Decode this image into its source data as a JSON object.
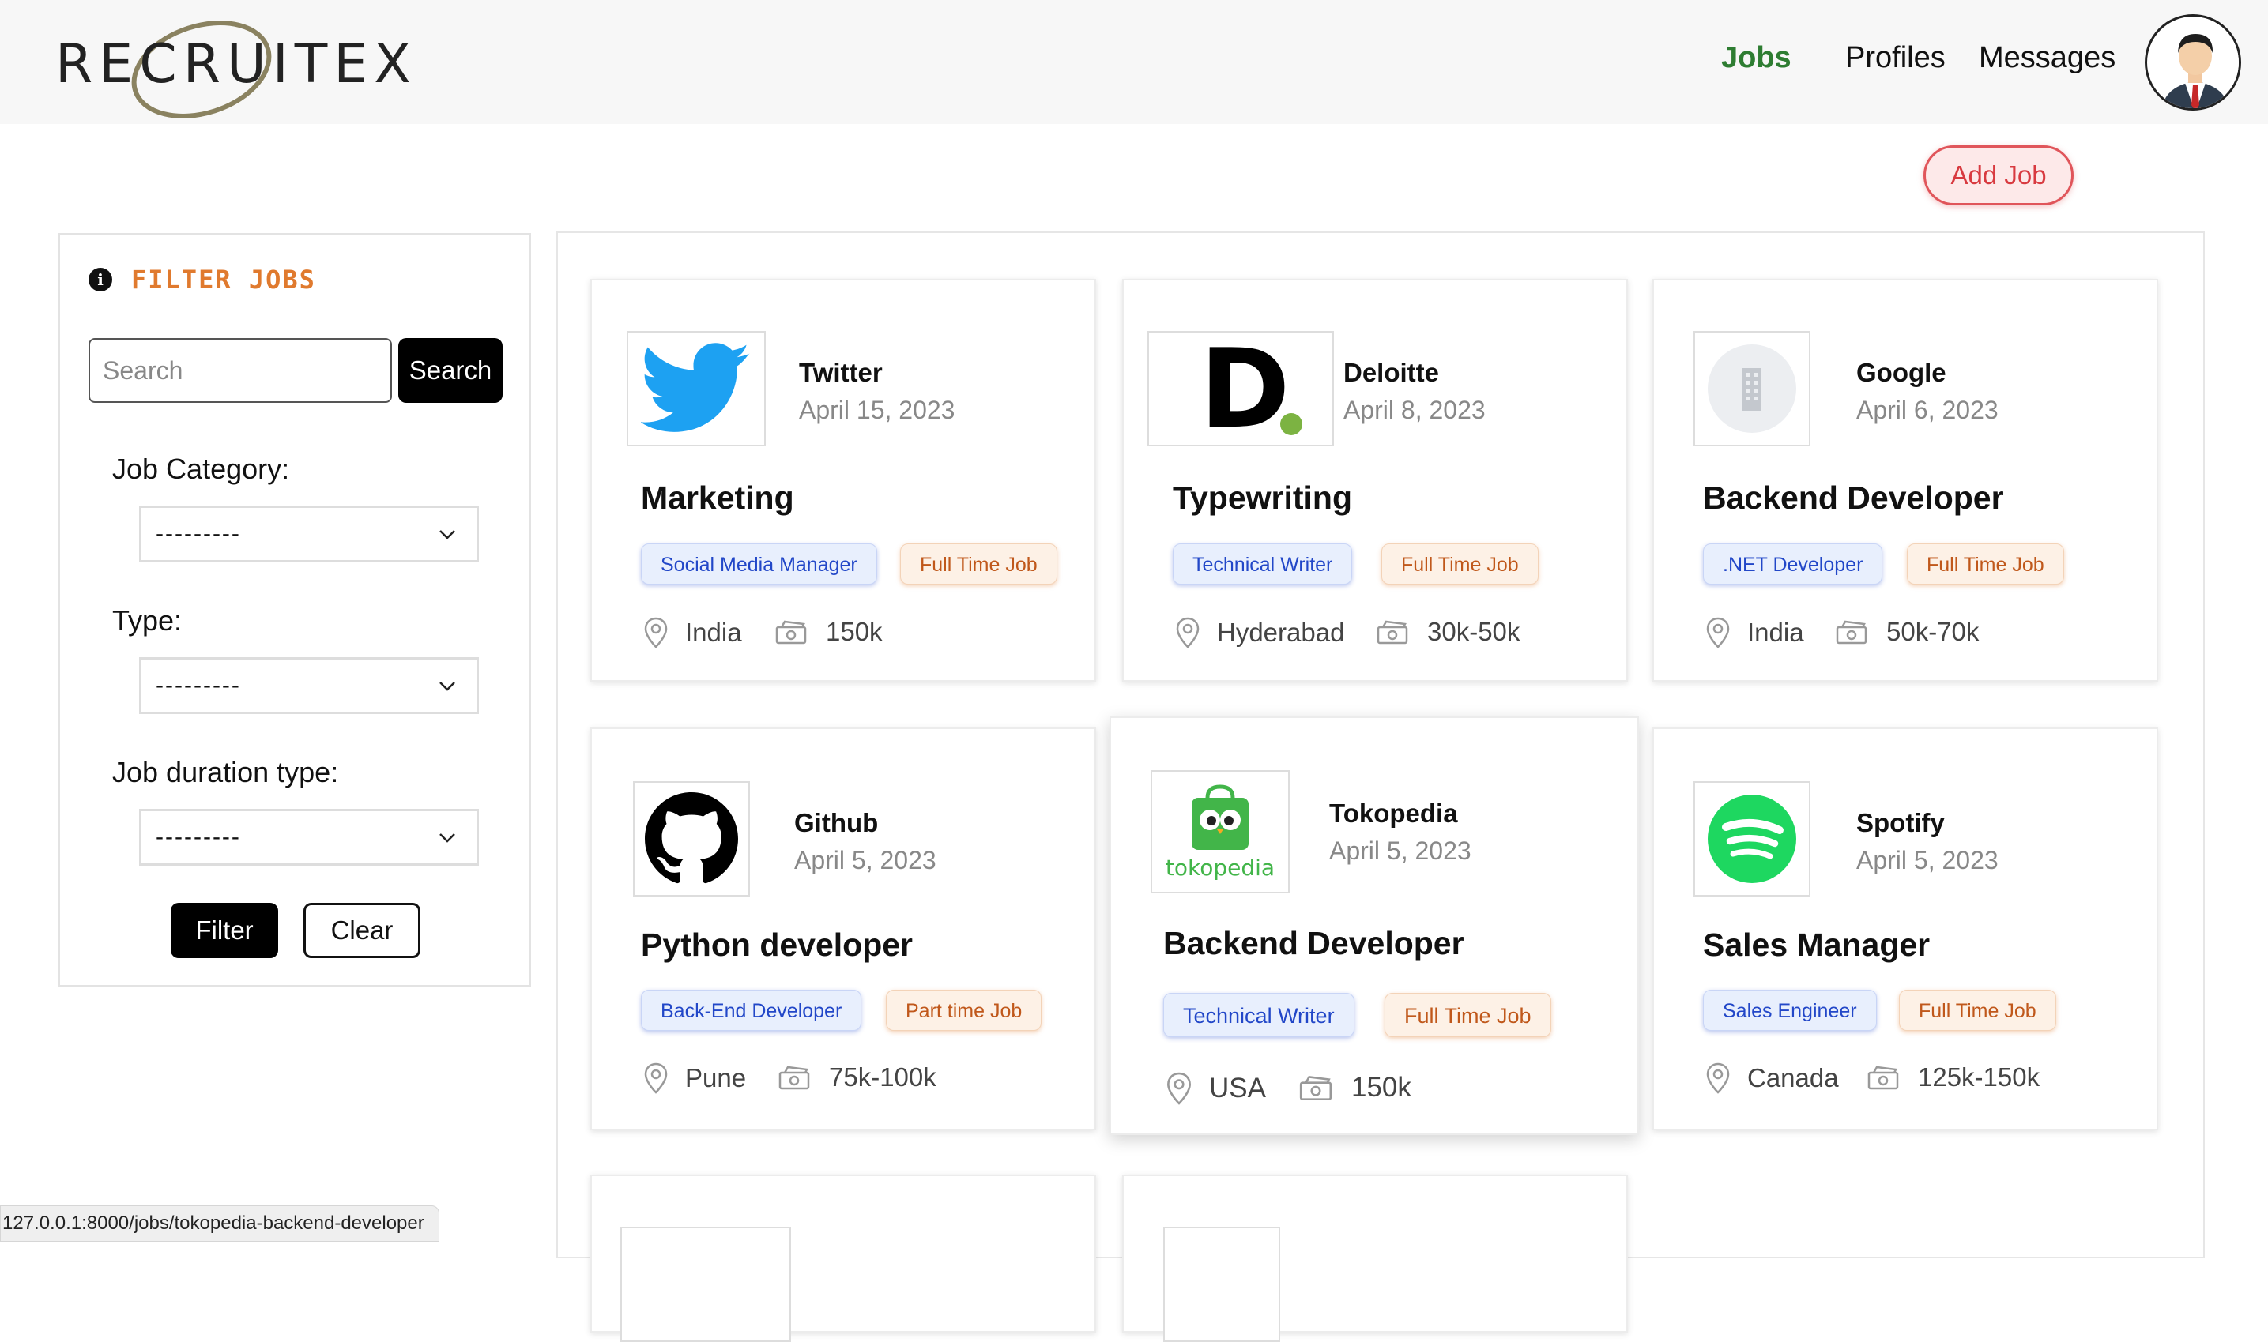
{
  "header": {
    "logo_text": "RECRUITEX",
    "nav": [
      "Jobs",
      "Profiles",
      "Messages"
    ],
    "active_nav": "Jobs",
    "avatar_icon": "user-avatar-icon"
  },
  "actions": {
    "add_job": "Add Job"
  },
  "filter": {
    "title": "FILTER JOBS",
    "search_placeholder": "Search",
    "search_button": "Search",
    "category_label": "Job Category:",
    "category_value": "---------",
    "type_label": "Type:",
    "type_value": "---------",
    "duration_label": "Job duration type:",
    "duration_value": "---------",
    "filter_button": "Filter",
    "clear_button": "Clear"
  },
  "jobs": [
    {
      "company": "Twitter",
      "date": "April 15, 2023",
      "title": "Marketing",
      "role_tag": "Social Media Manager",
      "type_tag": "Full Time Job",
      "location": "India",
      "salary": "150k",
      "logo": "twitter-bird"
    },
    {
      "company": "Deloitte",
      "date": "April 8, 2023",
      "title": "Typewriting",
      "role_tag": "Technical Writer",
      "type_tag": "Full Time Job",
      "location": "Hyderabad",
      "salary": "30k-50k",
      "logo": "deloitte-d"
    },
    {
      "company": "Google",
      "date": "April 6, 2023",
      "title": "Backend Developer",
      "role_tag": ".NET Developer",
      "type_tag": "Full Time Job",
      "location": "India",
      "salary": "50k-70k",
      "logo": "building-placeholder"
    },
    {
      "company": "Github",
      "date": "April 5, 2023",
      "title": "Python developer",
      "role_tag": "Back-End Developer",
      "type_tag": "Part time Job",
      "location": "Pune",
      "salary": "75k-100k",
      "logo": "github-octocat"
    },
    {
      "company": "Tokopedia",
      "date": "April 5, 2023",
      "title": "Backend Developer",
      "role_tag": "Technical Writer",
      "type_tag": "Full Time Job",
      "location": "USA",
      "salary": "150k",
      "logo": "tokopedia-owl",
      "logo_text": "tokopedia"
    },
    {
      "company": "Spotify",
      "date": "April 5, 2023",
      "title": "Sales Manager",
      "role_tag": "Sales Engineer",
      "type_tag": "Full Time Job",
      "location": "Canada",
      "salary": "125k-150k",
      "logo": "spotify-waves"
    }
  ],
  "colors": {
    "active_nav": "#2e7d32",
    "filter_title": "#e07a2e",
    "add_job": "#d83a40"
  },
  "status_url": "127.0.0.1:8000/jobs/tokopedia-backend-developer"
}
